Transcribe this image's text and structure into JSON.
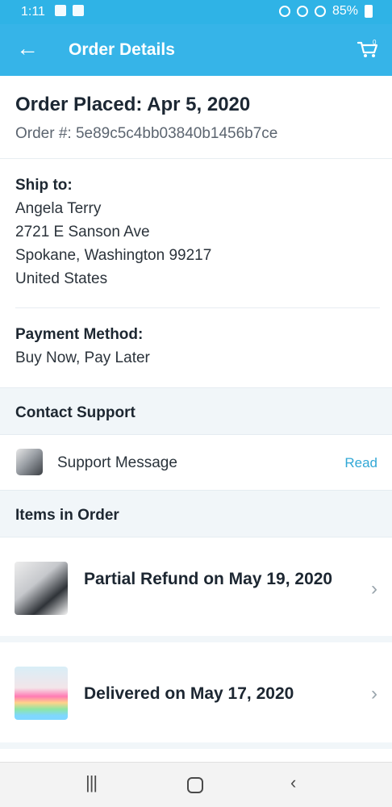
{
  "status_bar": {
    "time": "1:11",
    "battery": "85%"
  },
  "app_bar": {
    "title": "Order Details",
    "back_icon": "arrow-left-icon",
    "cart_icon": "cart-icon",
    "cart_count": "0"
  },
  "order": {
    "placed": "Order Placed: Apr 5, 2020",
    "number": "Order #: 5e89c5c4bb03840b1456b7ce"
  },
  "ship_to": {
    "label": "Ship to:",
    "name": "Angela Terry",
    "street": "2721 E Sanson Ave",
    "city_line": "Spokane, Washington 99217",
    "country": "United States"
  },
  "payment": {
    "label": "Payment Method:",
    "value": "Buy Now, Pay Later"
  },
  "contact_support": {
    "section_label": "Contact Support",
    "message_label": "Support Message",
    "read_label": "Read"
  },
  "items": {
    "section_label": "Items in Order",
    "list": [
      {
        "title": "Partial Refund on May 19, 2020"
      },
      {
        "title": "Delivered on May 17, 2020"
      }
    ]
  },
  "colors": {
    "accent": "#36b4e8",
    "link": "#32a8d6"
  }
}
